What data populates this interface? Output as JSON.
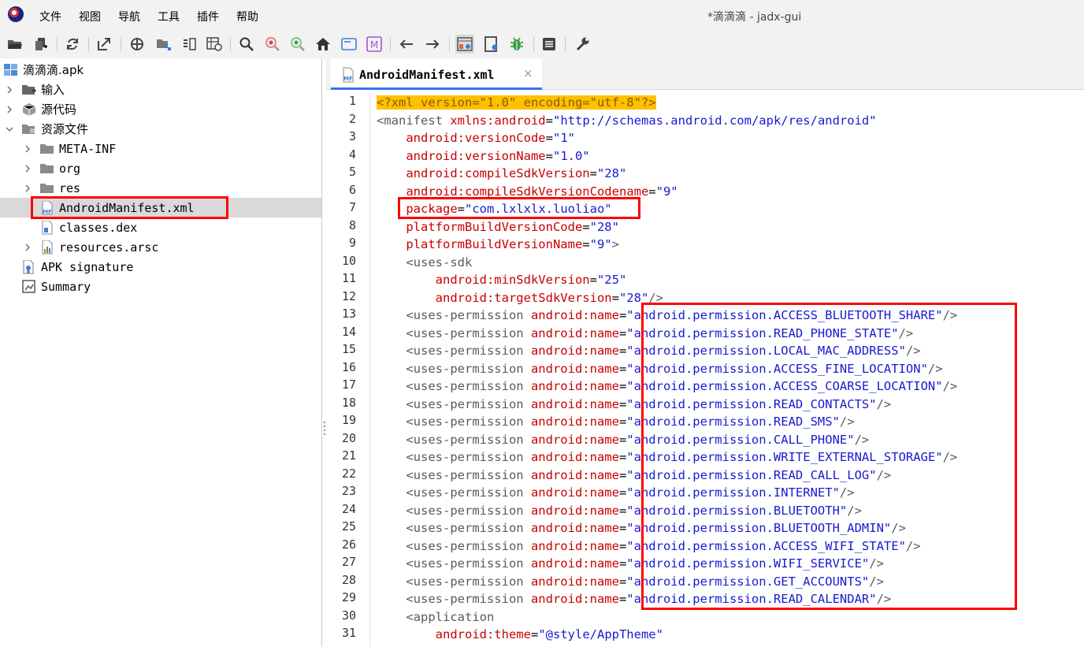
{
  "menubar": {
    "items": [
      "文件",
      "视图",
      "导航",
      "工具",
      "插件",
      "帮助"
    ],
    "window_title": "*滴滴滴 - jadx-gui"
  },
  "toolbar": {
    "icons": [
      "open-folder-icon",
      "add-files-icon",
      "reload-icon",
      "export-icon",
      "sync-target-icon",
      "flatten-packages-icon",
      "split-view-icon",
      "decompile-all-icon",
      "search-icon",
      "search-usage-icon",
      "search-comment-icon",
      "home-icon",
      "frame-icon",
      "smali-icon",
      "back-icon",
      "forward-icon",
      "deobfuscation-icon",
      "quick-tabs-icon",
      "debugger-icon",
      "log-icon",
      "preferences-icon"
    ]
  },
  "tree": {
    "items": [
      {
        "label": "滴滴滴.apk",
        "icon": "apk-icon"
      },
      {
        "label": "输入",
        "icon": "input-folder-icon"
      },
      {
        "label": "源代码",
        "icon": "source-package-icon"
      },
      {
        "label": "资源文件",
        "icon": "resources-folder-icon"
      },
      {
        "label": "META-INF",
        "icon": "folder-icon"
      },
      {
        "label": "org",
        "icon": "folder-icon"
      },
      {
        "label": "res",
        "icon": "folder-icon"
      },
      {
        "label": "AndroidManifest.xml",
        "icon": "manifest-file-icon"
      },
      {
        "label": "classes.dex",
        "icon": "dex-file-icon"
      },
      {
        "label": "resources.arsc",
        "icon": "arsc-file-icon"
      },
      {
        "label": "APK signature",
        "icon": "signature-icon"
      },
      {
        "label": "Summary",
        "icon": "summary-icon"
      }
    ],
    "selected": "AndroidManifest.xml"
  },
  "editor": {
    "tab_label": "AndroidManifest.xml",
    "tab_close": "×",
    "lines": [
      [
        [
          "decl",
          "<?xml version=\"1.0\" encoding=\"utf-8\"?>"
        ]
      ],
      [
        [
          "tag",
          "<manifest "
        ],
        [
          "attr",
          "xmlns:android"
        ],
        [
          "eq",
          "="
        ],
        [
          "val",
          "\"http://schemas.android.com/apk/res/android\""
        ]
      ],
      [
        [
          "sp",
          "    "
        ],
        [
          "attr",
          "android:versionCode"
        ],
        [
          "eq",
          "="
        ],
        [
          "val",
          "\"1\""
        ]
      ],
      [
        [
          "sp",
          "    "
        ],
        [
          "attr",
          "android:versionName"
        ],
        [
          "eq",
          "="
        ],
        [
          "val",
          "\"1.0\""
        ]
      ],
      [
        [
          "sp",
          "    "
        ],
        [
          "attr",
          "android:compileSdkVersion"
        ],
        [
          "eq",
          "="
        ],
        [
          "val",
          "\"28\""
        ]
      ],
      [
        [
          "sp",
          "    "
        ],
        [
          "attr",
          "android:compileSdkVersionCodename"
        ],
        [
          "eq",
          "="
        ],
        [
          "val",
          "\"9\""
        ]
      ],
      [
        [
          "sp",
          "    "
        ],
        [
          "attr",
          "package"
        ],
        [
          "eq",
          "="
        ],
        [
          "val",
          "\"com.lxlxlx.luoliao\""
        ]
      ],
      [
        [
          "sp",
          "    "
        ],
        [
          "attr",
          "platformBuildVersionCode"
        ],
        [
          "eq",
          "="
        ],
        [
          "val",
          "\"28\""
        ]
      ],
      [
        [
          "sp",
          "    "
        ],
        [
          "attr",
          "platformBuildVersionName"
        ],
        [
          "eq",
          "="
        ],
        [
          "val",
          "\"9\""
        ],
        [
          "tag",
          ">"
        ]
      ],
      [
        [
          "sp",
          "    "
        ],
        [
          "tag",
          "<uses-sdk"
        ]
      ],
      [
        [
          "sp",
          "        "
        ],
        [
          "attr",
          "android:minSdkVersion"
        ],
        [
          "eq",
          "="
        ],
        [
          "val",
          "\"25\""
        ]
      ],
      [
        [
          "sp",
          "        "
        ],
        [
          "attr",
          "android:targetSdkVersion"
        ],
        [
          "eq",
          "="
        ],
        [
          "val",
          "\"28\""
        ],
        [
          "tag",
          "/>"
        ]
      ],
      [
        [
          "sp",
          "    "
        ],
        [
          "tag",
          "<uses-permission "
        ],
        [
          "attr",
          "android:name"
        ],
        [
          "eq",
          "="
        ],
        [
          "val",
          "\"android.permission.ACCESS_BLUETOOTH_SHARE\""
        ],
        [
          "tag",
          "/>"
        ]
      ],
      [
        [
          "sp",
          "    "
        ],
        [
          "tag",
          "<uses-permission "
        ],
        [
          "attr",
          "android:name"
        ],
        [
          "eq",
          "="
        ],
        [
          "val",
          "\"android.permission.READ_PHONE_STATE\""
        ],
        [
          "tag",
          "/>"
        ]
      ],
      [
        [
          "sp",
          "    "
        ],
        [
          "tag",
          "<uses-permission "
        ],
        [
          "attr",
          "android:name"
        ],
        [
          "eq",
          "="
        ],
        [
          "val",
          "\"android.permission.LOCAL_MAC_ADDRESS\""
        ],
        [
          "tag",
          "/>"
        ]
      ],
      [
        [
          "sp",
          "    "
        ],
        [
          "tag",
          "<uses-permission "
        ],
        [
          "attr",
          "android:name"
        ],
        [
          "eq",
          "="
        ],
        [
          "val",
          "\"android.permission.ACCESS_FINE_LOCATION\""
        ],
        [
          "tag",
          "/>"
        ]
      ],
      [
        [
          "sp",
          "    "
        ],
        [
          "tag",
          "<uses-permission "
        ],
        [
          "attr",
          "android:name"
        ],
        [
          "eq",
          "="
        ],
        [
          "val",
          "\"android.permission.ACCESS_COARSE_LOCATION\""
        ],
        [
          "tag",
          "/>"
        ]
      ],
      [
        [
          "sp",
          "    "
        ],
        [
          "tag",
          "<uses-permission "
        ],
        [
          "attr",
          "android:name"
        ],
        [
          "eq",
          "="
        ],
        [
          "val",
          "\"android.permission.READ_CONTACTS\""
        ],
        [
          "tag",
          "/>"
        ]
      ],
      [
        [
          "sp",
          "    "
        ],
        [
          "tag",
          "<uses-permission "
        ],
        [
          "attr",
          "android:name"
        ],
        [
          "eq",
          "="
        ],
        [
          "val",
          "\"android.permission.READ_SMS\""
        ],
        [
          "tag",
          "/>"
        ]
      ],
      [
        [
          "sp",
          "    "
        ],
        [
          "tag",
          "<uses-permission "
        ],
        [
          "attr",
          "android:name"
        ],
        [
          "eq",
          "="
        ],
        [
          "val",
          "\"android.permission.CALL_PHONE\""
        ],
        [
          "tag",
          "/>"
        ]
      ],
      [
        [
          "sp",
          "    "
        ],
        [
          "tag",
          "<uses-permission "
        ],
        [
          "attr",
          "android:name"
        ],
        [
          "eq",
          "="
        ],
        [
          "val",
          "\"android.permission.WRITE_EXTERNAL_STORAGE\""
        ],
        [
          "tag",
          "/>"
        ]
      ],
      [
        [
          "sp",
          "    "
        ],
        [
          "tag",
          "<uses-permission "
        ],
        [
          "attr",
          "android:name"
        ],
        [
          "eq",
          "="
        ],
        [
          "val",
          "\"android.permission.READ_CALL_LOG\""
        ],
        [
          "tag",
          "/>"
        ]
      ],
      [
        [
          "sp",
          "    "
        ],
        [
          "tag",
          "<uses-permission "
        ],
        [
          "attr",
          "android:name"
        ],
        [
          "eq",
          "="
        ],
        [
          "val",
          "\"android.permission.INTERNET\""
        ],
        [
          "tag",
          "/>"
        ]
      ],
      [
        [
          "sp",
          "    "
        ],
        [
          "tag",
          "<uses-permission "
        ],
        [
          "attr",
          "android:name"
        ],
        [
          "eq",
          "="
        ],
        [
          "val",
          "\"android.permission.BLUETOOTH\""
        ],
        [
          "tag",
          "/>"
        ]
      ],
      [
        [
          "sp",
          "    "
        ],
        [
          "tag",
          "<uses-permission "
        ],
        [
          "attr",
          "android:name"
        ],
        [
          "eq",
          "="
        ],
        [
          "val",
          "\"android.permission.BLUETOOTH_ADMIN\""
        ],
        [
          "tag",
          "/>"
        ]
      ],
      [
        [
          "sp",
          "    "
        ],
        [
          "tag",
          "<uses-permission "
        ],
        [
          "attr",
          "android:name"
        ],
        [
          "eq",
          "="
        ],
        [
          "val",
          "\"android.permission.ACCESS_WIFI_STATE\""
        ],
        [
          "tag",
          "/>"
        ]
      ],
      [
        [
          "sp",
          "    "
        ],
        [
          "tag",
          "<uses-permission "
        ],
        [
          "attr",
          "android:name"
        ],
        [
          "eq",
          "="
        ],
        [
          "val",
          "\"android.permission.WIFI_SERVICE\""
        ],
        [
          "tag",
          "/>"
        ]
      ],
      [
        [
          "sp",
          "    "
        ],
        [
          "tag",
          "<uses-permission "
        ],
        [
          "attr",
          "android:name"
        ],
        [
          "eq",
          "="
        ],
        [
          "val",
          "\"android.permission.GET_ACCOUNTS\""
        ],
        [
          "tag",
          "/>"
        ]
      ],
      [
        [
          "sp",
          "    "
        ],
        [
          "tag",
          "<uses-permission "
        ],
        [
          "attr",
          "android:name"
        ],
        [
          "eq",
          "="
        ],
        [
          "val",
          "\"android.permission.READ_CALENDAR\""
        ],
        [
          "tag",
          "/>"
        ]
      ],
      [
        [
          "sp",
          "    "
        ],
        [
          "tag",
          "<application"
        ]
      ],
      [
        [
          "sp",
          "        "
        ],
        [
          "attr",
          "android:theme"
        ],
        [
          "eq",
          "="
        ],
        [
          "val",
          "\"@style/AppTheme\""
        ]
      ]
    ]
  },
  "colors": {
    "highlight": "#ffc000",
    "annotation": "#ff0000",
    "attr": "#c80000",
    "value": "#1919d2",
    "tag": "#5a5a5a"
  }
}
